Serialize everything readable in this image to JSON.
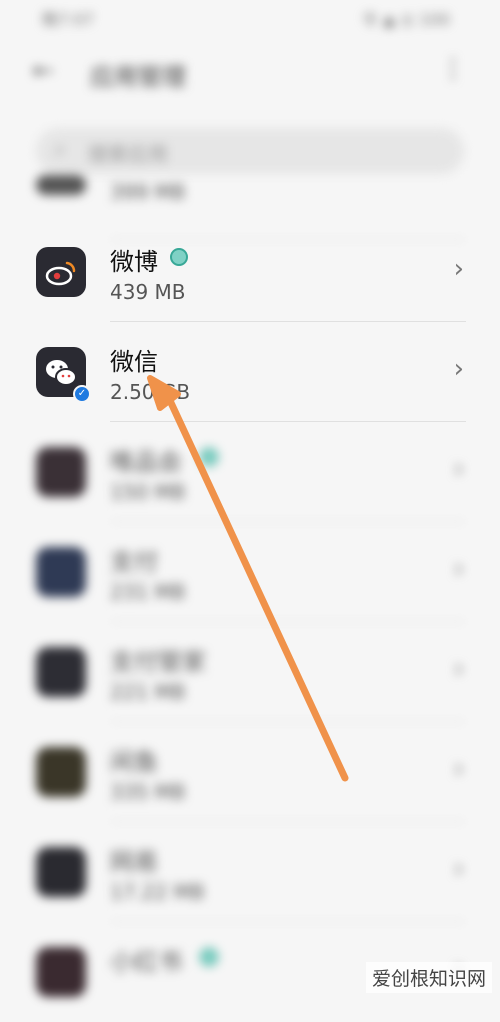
{
  "statusbar": {
    "time": "晚7:07",
    "icons": "令 ▲ ◎ 100"
  },
  "header": {
    "back_icon": "arrow-left-icon",
    "title": "应用管理",
    "more_icon": "more-vertical-icon"
  },
  "search": {
    "placeholder": "搜索应用"
  },
  "apps": [
    {
      "name": "",
      "size": "399 MB"
    },
    {
      "name": "微博",
      "size": "439 MB"
    },
    {
      "name": "微信",
      "size": "2.50 GB"
    },
    {
      "name": "唯品会",
      "size": "150 MB"
    },
    {
      "name": "支付",
      "size": "231 MB"
    },
    {
      "name": "支付管家",
      "size": "221 MB"
    },
    {
      "name": "闲鱼",
      "size": "335 MB"
    },
    {
      "name": "网易",
      "size": "17.22 MB"
    },
    {
      "name": "小红书",
      "size": ""
    }
  ],
  "colors": {
    "annotation_arrow": "#f0924a",
    "verify_badge": "#1f7ae0",
    "weibo_badge": "#38a897"
  },
  "watermark": "爱创根知识网"
}
